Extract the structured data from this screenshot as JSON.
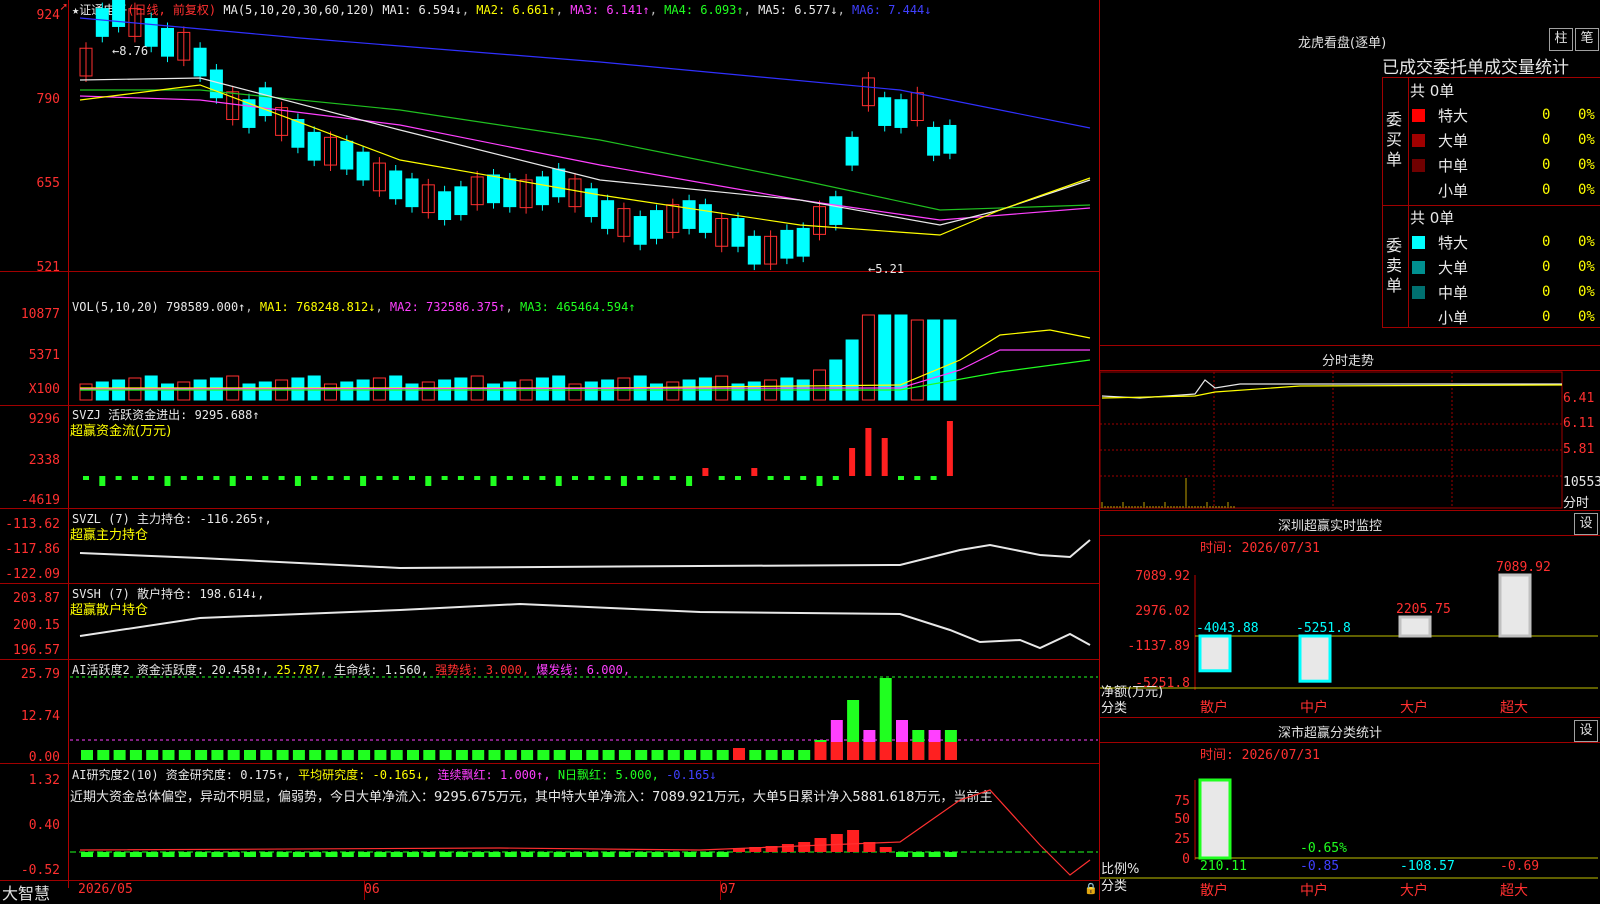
{
  "stock": {
    "name": "★证通电子",
    "period": "(日线, 前复权)"
  },
  "ma_line": {
    "label": "MA(5,10,20,30,60,120)",
    "ma1": "MA1: 6.594↓",
    "ma2": "MA2: 6.661↑",
    "ma3": "MA3: 6.141↑",
    "ma4": "MA4: 6.093↑",
    "ma5": "MA5: 6.577↓",
    "ma6": "MA6: 7.444↓"
  },
  "price_axis": [
    "924",
    "790",
    "655",
    "521"
  ],
  "price_marks": {
    "high": "8.76",
    "low": "5.21"
  },
  "vol": {
    "label": "VOL(5,10,20)",
    "value": "798589.000↑",
    "ma1": "MA1: 768248.812↓",
    "ma2": "MA2: 732586.375↑",
    "ma3": "MA3: 465464.594↑",
    "axis": [
      "10877",
      "5371",
      "X100"
    ]
  },
  "svzj": {
    "label": "SVZJ  活跃资金进出: 9295.688↑",
    "sub": "超赢资金流(万元)",
    "axis": [
      "9296",
      "2338",
      "-4619"
    ]
  },
  "svzl": {
    "label": "SVZL (7) 主力持仓: -116.265↑,",
    "sub": "超赢主力持仓",
    "axis": [
      "-113.62",
      "-117.86",
      "-122.09"
    ]
  },
  "svsh": {
    "label": "SVSH (7) 散户持仓: 198.614↓,",
    "sub": "超赢散户持仓",
    "axis": [
      "203.87",
      "200.15",
      "196.57"
    ]
  },
  "ai_active": {
    "label": "AI活跃度2 资金活跃度: 20.458↑,",
    "avg": "25.787",
    "life": "生命线: 1.560,",
    "strong": "强势线: 3.000,",
    "burst": "爆发线: 6.000,",
    "axis": [
      "25.79",
      "12.74",
      "0.00"
    ]
  },
  "ai_research": {
    "label": "AI研究度2(10) 资金研究度: 0.175↑,",
    "avg": "平均研究度: -0.165↓,",
    "red": "连续飘红: 1.000↑,",
    "nred": "N日飘红: 5.000,",
    "last": "-0.165↓",
    "comment": "近期大资金总体偏空，异动不明显，偏弱势，今日大单净流入：9295.675万元，其中特大单净流入：7089.921万元，大单5日累计净入5881.618万元，当前主",
    "axis": [
      "1.32",
      "0.40",
      "-0.52"
    ]
  },
  "date_axis": {
    "brand": "大智慧",
    "labels": [
      "2026/05",
      "06",
      "07"
    ]
  },
  "dragon": {
    "title": "龙虎看盘(逐单)",
    "btn1": "柱",
    "btn2": "笔",
    "header": "已成交委托单成交量统计",
    "buy_label": "委买单",
    "sell_label": "委卖单",
    "buy_total": "共 0单",
    "sell_total": "共 0单",
    "rows_buy": [
      {
        "name": "特大",
        "count": "0",
        "pct": "0%",
        "color": "#ff0000"
      },
      {
        "name": "大单",
        "count": "0",
        "pct": "0%",
        "color": "#a00000"
      },
      {
        "name": "中单",
        "count": "0",
        "pct": "0%",
        "color": "#700000"
      },
      {
        "name": "小单",
        "count": "0",
        "pct": "0%",
        "color": "#000000"
      }
    ],
    "rows_sell": [
      {
        "name": "特大",
        "count": "0",
        "pct": "0%",
        "color": "#00ffff"
      },
      {
        "name": "大单",
        "count": "0",
        "pct": "0%",
        "color": "#009090"
      },
      {
        "name": "中单",
        "count": "0",
        "pct": "0%",
        "color": "#007070"
      },
      {
        "name": "小单",
        "count": "0",
        "pct": "0%",
        "color": "#000000"
      }
    ]
  },
  "minute": {
    "title": "分时走势",
    "axis": [
      "6.41",
      "6.11",
      "5.81",
      "10553"
    ],
    "foot": "分时"
  },
  "sz_monitor": {
    "title": "深圳超赢实时监控",
    "btn": "设",
    "time": "时间: 2026/07/31",
    "axis": [
      "7089.92",
      "2976.02",
      "-1137.89",
      "-5251.8"
    ],
    "cats": [
      "散户",
      "中户",
      "大户",
      "超大"
    ],
    "values": [
      "-4043.88",
      "-5251.8",
      "2205.75",
      "7089.92"
    ],
    "unit_label": "净额(万元)",
    "cat_label": "分类"
  },
  "sz_class": {
    "title": "深市超赢分类统计",
    "btn": "设",
    "time": "时间: 2026/07/31",
    "axis": [
      "75",
      "50",
      "25",
      "0"
    ],
    "cats": [
      "散户",
      "中户",
      "大户",
      "超大"
    ],
    "values": [
      "210.11",
      "-0.85",
      "-108.57",
      "-0.69"
    ],
    "pct": "-0.65%",
    "unit_label": "比例%",
    "cat_label": "分类"
  }
}
